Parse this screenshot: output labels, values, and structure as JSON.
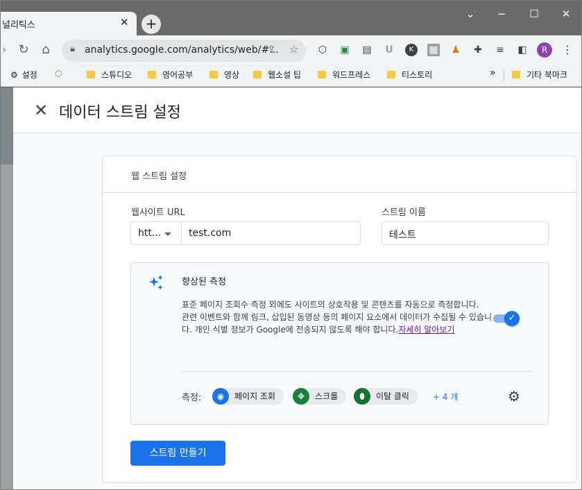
{
  "browser": {
    "tab_title": "널리틱스",
    "tab_close": "✕",
    "new_tab": "+",
    "window_controls": {
      "minimize": "⌄",
      "restore": "−",
      "maximize": "☐",
      "close": "✕"
    },
    "address": "analytics.google.com/analytics/web/#...",
    "avatar_letter": "R",
    "bookmarks": [
      "설정",
      "스튜디오",
      "영어공부",
      "영상",
      "웹소설 팁",
      "워드프레스",
      "티스토리"
    ],
    "bookmarks_overflow": "»",
    "other_bookmarks": "기타 북마크"
  },
  "panel": {
    "title": "데이터 스트림 설정",
    "close_icon": "close-icon"
  },
  "card": {
    "title": "웹 스트림 설정",
    "website_url_label": "웹사이트 URL",
    "protocol_value": "htt...",
    "url_value": "test.com",
    "stream_name_label": "스트림 이름",
    "stream_name_value": "테스트",
    "enhanced": {
      "title": "향상된 측정",
      "desc_line1": "표준 페이지 조회수 측정 외에도 사이트의 상호작용 및 콘텐츠를 자동으로 측정합니다.",
      "desc_line2": "관련 이벤트와 함께 링크, 삽입된 동영상 등의 페이지 요소에서 데이터가 수집될 수 있습니다. 개인 식별 정보가 Google에 전송되지 않도록 해야 합니다.",
      "learn_more": "자세히 알아보기",
      "enabled": true,
      "measure_label": "측정:",
      "chips": [
        "페이지 조회",
        "스크롤",
        "이탈 클릭"
      ],
      "more": "+ 4 개"
    },
    "create_button": "스트림 만들기"
  },
  "colors": {
    "accent": "#1a73e8",
    "toggle_track": "#8ab4f8",
    "link_visited": "#6a1b9a"
  }
}
